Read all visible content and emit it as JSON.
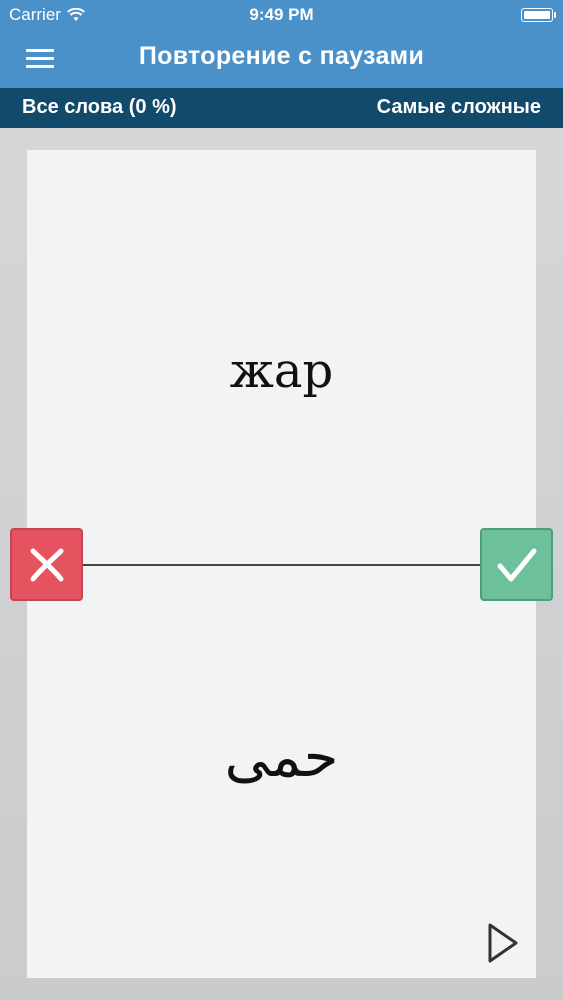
{
  "status_bar": {
    "carrier": "Carrier",
    "time": "9:49 PM"
  },
  "nav": {
    "title": "Повторение с паузами",
    "menu_icon": "hamburger-menu-icon"
  },
  "filter_bar": {
    "left_label": "Все слова (0 %)",
    "right_label": "Самые сложные"
  },
  "card": {
    "word": "жар",
    "translation": "حمى"
  },
  "actions": {
    "wrong_icon": "x-icon",
    "correct_icon": "checkmark-icon",
    "play_icon": "play-icon"
  },
  "colors": {
    "header": "#4a90c9",
    "subbar": "#124a6b",
    "wrong": "#e4535f",
    "correct": "#6cc09b"
  }
}
